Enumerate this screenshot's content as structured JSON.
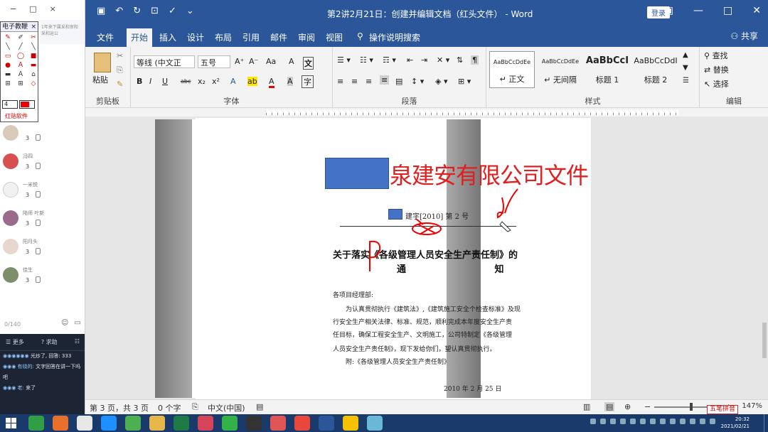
{
  "left_panel": {
    "top_controls": [
      "−",
      "□",
      "×"
    ],
    "side_tab_text": "1年来下属采和审和",
    "side_tab_text2": "采和运公",
    "tool_panel_title": "电子教鞭",
    "tool_panel_close": "×",
    "tool_grid": [
      "✎",
      "✐",
      "✂",
      "╲",
      "╱",
      "╲",
      "▭",
      "◯",
      "■",
      "●",
      "Ａ",
      "▬",
      "▬",
      "Ａ",
      "⌂",
      "⊞",
      "⊞",
      "◇"
    ],
    "size_value": "4",
    "tool_label": "红贴软件",
    "users": [
      {
        "name": "",
        "count": "3",
        "color": "#d9c9b9"
      },
      {
        "name": "冯四",
        "count": "3",
        "color": "#d65050"
      },
      {
        "name": "一米悦",
        "count": "3",
        "color": "#f1f1f1"
      },
      {
        "name": "陆师 叶新",
        "count": "3",
        "color": "#9b6b8b"
      },
      {
        "name": "阳月头",
        "count": "3",
        "color": "#e8d7cf"
      },
      {
        "name": "佳生",
        "count": "3",
        "color": "#7d8f6a"
      }
    ],
    "counter": "0/140",
    "chat": {
      "header_left": "☰ 更多",
      "header_mid": "? 求助",
      "header_right": "☷",
      "messages": [
        {
          "user": "◉◉◉◉◉◉",
          "text": "光炒了, 回答: 333"
        },
        {
          "user": "◉◉◉ 有绕的:",
          "text": "文字回答在讲一下吗"
        },
        {
          "user": "",
          "text": "吧"
        },
        {
          "user": "◉◉◉ 老:",
          "text": "来了"
        }
      ]
    }
  },
  "word": {
    "quick_access": [
      "▣",
      "↶",
      "↻",
      "⊡",
      "✓",
      "⌄"
    ],
    "title": "第2讲2月21日：创建并编辑文档（红头文件） - Word",
    "login_label": "登录",
    "window_controls": [
      "▣",
      "—",
      "□",
      "✕"
    ],
    "tabs": [
      "文件",
      "开始",
      "插入",
      "设计",
      "布局",
      "引用",
      "邮件",
      "审阅",
      "视图",
      "操作说明搜索"
    ],
    "active_tab": "开始",
    "share_label": "共享",
    "ribbon": {
      "clipboard_label": "剪贴板",
      "paste_label": "粘贴",
      "font_label": "字体",
      "font_name": "等线 (中文正",
      "font_size": "五号",
      "font_buttons": [
        "A⁺",
        "A⁻",
        "Aa",
        "A"
      ],
      "format_buttons": [
        "B",
        "I",
        "U",
        "abc",
        "x₂",
        "x²",
        "A",
        "ab",
        "A",
        "A"
      ],
      "paragraph_label": "段落",
      "styles_label": "样式",
      "styles": [
        {
          "sample": "AaBbCcDdEe",
          "name": "↵ 正文"
        },
        {
          "sample": "AaBbCcDdEe",
          "name": "↵ 无间隔"
        },
        {
          "sample": "AaBbCcI",
          "name": "标题 1"
        },
        {
          "sample": "AaBbCcDdI",
          "name": "标题 2"
        }
      ],
      "editing_label": "编辑",
      "editing_items": [
        "查找",
        "替换",
        "选择"
      ]
    },
    "document": {
      "red_title": "泉建安有限公司文件",
      "doc_number": "建字[2010] 第 2 号",
      "subject_line1": "关于落实《各级管理人员安全生产责任制》的",
      "subject_line2": "通 知",
      "lines": [
        "各项目经理部:",
        "为认真贯彻执行《建筑法》,《建筑施工安全个检查标准》及现",
        "行安全生产相关法律、标准、规范，顺利完成本年度安全生产责",
        "任目标，确保工程安全生产、文明施工，公司特制定《各级管理",
        "人员安全生产责任制》，现下发给你们，望认真贯彻执行。",
        "附:《各级管理人员安全生产责任制》",
        "2010 年 2 月 25 日"
      ]
    },
    "status": {
      "page": "第 3 页，共 3 页",
      "words": "0 个字",
      "lang": "中文(中国)",
      "zoom": "147%"
    },
    "ime_label": "五笔拼音"
  },
  "taskbar": {
    "icons": [
      {
        "name": "browser-icon",
        "color": "#2f9e44"
      },
      {
        "name": "firefox-icon",
        "color": "#e8702a"
      },
      {
        "name": "chrome-icon",
        "color": "#e7e7e7"
      },
      {
        "name": "app-icon",
        "color": "#1e90ff"
      },
      {
        "name": "camtasia-icon",
        "color": "#4caf50"
      },
      {
        "name": "folder-icon",
        "color": "#e6b84a"
      },
      {
        "name": "excel-icon",
        "color": "#1f7a45"
      },
      {
        "name": "app-icon",
        "color": "#d4445a"
      },
      {
        "name": "wechat-icon",
        "color": "#34b24a"
      },
      {
        "name": "obs-icon",
        "color": "#333333"
      },
      {
        "name": "app-icon",
        "color": "#e05555"
      },
      {
        "name": "app-icon",
        "color": "#e9463c"
      },
      {
        "name": "word-icon",
        "color": "#2b579a"
      },
      {
        "name": "app-icon",
        "color": "#f5c200"
      },
      {
        "name": "app-icon",
        "color": "#6bb7d8"
      }
    ],
    "time": "20:32",
    "date": "2021/02/21"
  }
}
